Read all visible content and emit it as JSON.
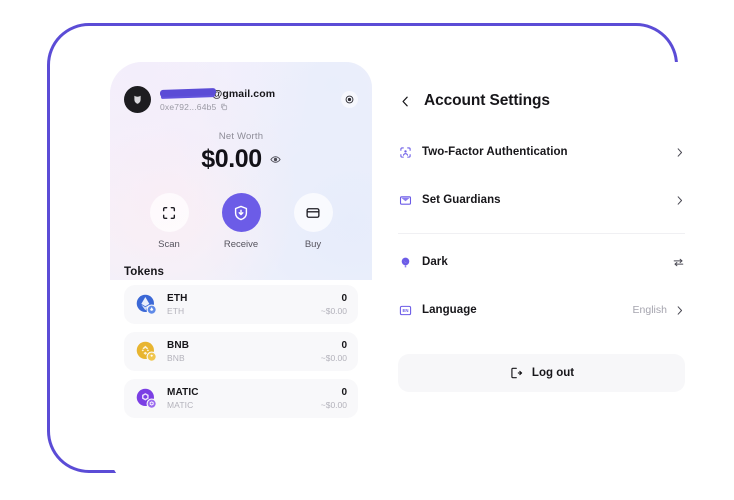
{
  "wallet": {
    "account": {
      "email": "@gmail.com",
      "email_redacted": true,
      "address": "0xe792...64b5",
      "copy_icon": "copy-icon",
      "avatar_icon": "avatar-shield-icon",
      "settings_icon": "gear-icon"
    },
    "net_worth": {
      "label": "Net Worth",
      "value": "$0.00",
      "visibility_icon": "eye-icon"
    },
    "actions": [
      {
        "label": "Scan",
        "icon": "scan-qr-icon",
        "primary": false
      },
      {
        "label": "Receive",
        "icon": "receive-download-icon",
        "primary": true
      },
      {
        "label": "Buy",
        "icon": "card-icon",
        "primary": false
      }
    ],
    "tokens_title": "Tokens",
    "tokens": [
      {
        "symbol": "ETH",
        "name": "ETH",
        "balance": "0",
        "fiat": "~$0.00",
        "color": "#3b68d6",
        "icon": "eth-token-icon"
      },
      {
        "symbol": "BNB",
        "name": "BNB",
        "balance": "0",
        "fiat": "~$0.00",
        "color": "#e8b530",
        "icon": "bnb-token-icon"
      },
      {
        "symbol": "MATIC",
        "name": "MATIC",
        "balance": "0",
        "fiat": "~$0.00",
        "color": "#7b3fe4",
        "icon": "matic-token-icon"
      }
    ]
  },
  "settings": {
    "back_icon": "chevron-left-icon",
    "title": "Account Settings",
    "rows": [
      {
        "label": "Two-Factor Authentication",
        "icon": "face-scan-icon",
        "value": "",
        "trailing": "chevron-right-icon"
      },
      {
        "label": "Set Guardians",
        "icon": "envelope-icon",
        "value": "",
        "trailing": "chevron-right-icon"
      },
      {
        "label": "Dark",
        "icon": "moon-icon",
        "value": "",
        "trailing": "swap-toggle-icon"
      },
      {
        "label": "Language",
        "icon": "language-en-icon",
        "value": "English",
        "trailing": "chevron-right-icon"
      }
    ],
    "logout": {
      "label": "Log out",
      "icon": "logout-icon"
    }
  },
  "theme": {
    "frame_purple": "#5b4cd6",
    "accent": "#6c5ce7",
    "text_dark": "#17161a",
    "text_muted": "#b3b2bb",
    "row_bg": "#f8f8fa"
  }
}
